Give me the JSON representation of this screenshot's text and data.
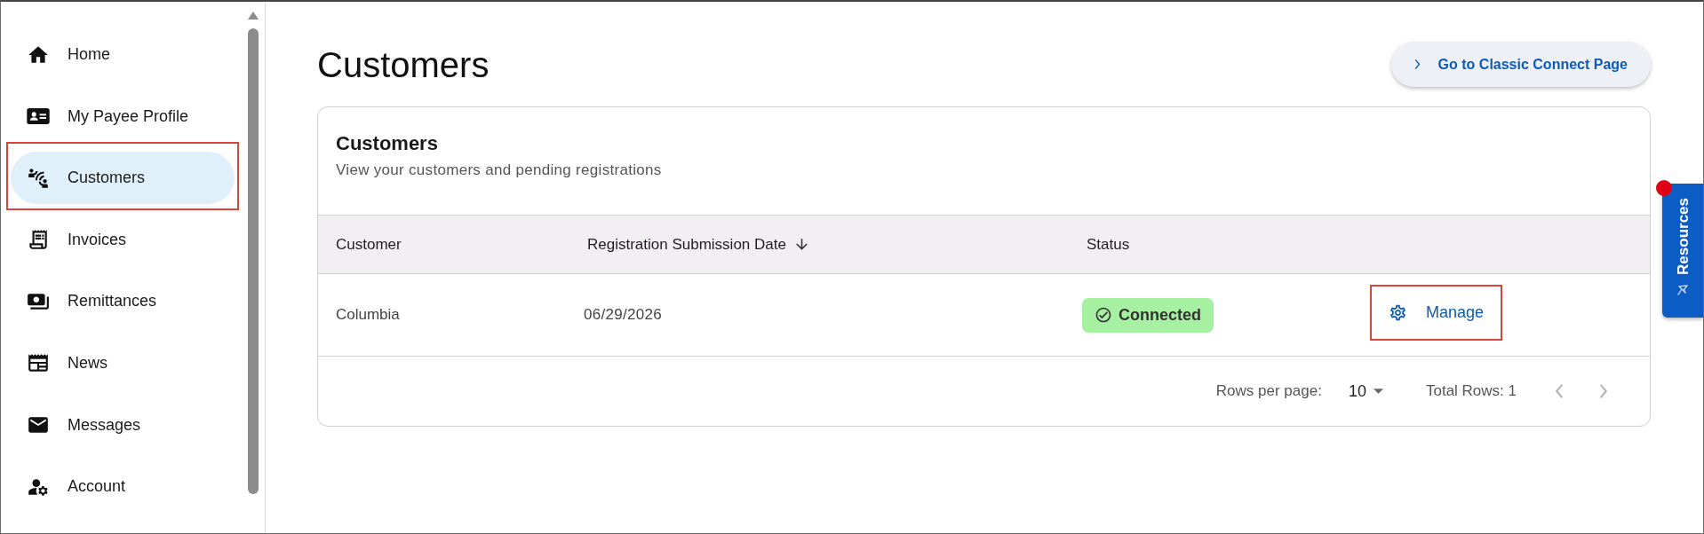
{
  "sidebar": {
    "items": [
      {
        "label": "Home",
        "selected": false,
        "highlighted": false
      },
      {
        "label": "My Payee Profile",
        "selected": false,
        "highlighted": false
      },
      {
        "label": "Customers",
        "selected": true,
        "highlighted": true
      },
      {
        "label": "Invoices",
        "selected": false,
        "highlighted": false
      },
      {
        "label": "Remittances",
        "selected": false,
        "highlighted": false
      },
      {
        "label": "News",
        "selected": false,
        "highlighted": false
      },
      {
        "label": "Messages",
        "selected": false,
        "highlighted": false
      },
      {
        "label": "Account",
        "selected": false,
        "highlighted": false
      }
    ]
  },
  "page": {
    "title": "Customers",
    "action_button": {
      "label": "Go to Classic Connect Page"
    }
  },
  "card": {
    "title": "Customers",
    "subtitle": "View your customers and pending registrations",
    "table": {
      "columns": [
        {
          "label": "Customer"
        },
        {
          "label": "Registration Submission Date",
          "sorted": true
        },
        {
          "label": "Status"
        }
      ],
      "rows": [
        {
          "customer": "Columbia",
          "registration_date": "06/29/2026",
          "status": {
            "label": "Connected",
            "kind": "connected"
          },
          "action": {
            "label": "Manage",
            "highlighted": true
          }
        }
      ]
    },
    "pagination": {
      "rows_per_page_label": "Rows per page:",
      "rows_per_page": "10",
      "total": "Total Rows: 1",
      "prev": {
        "disabled": true
      },
      "next": {
        "disabled": true
      }
    }
  },
  "resources_tab": {
    "label": "Resources",
    "notification": true
  }
}
